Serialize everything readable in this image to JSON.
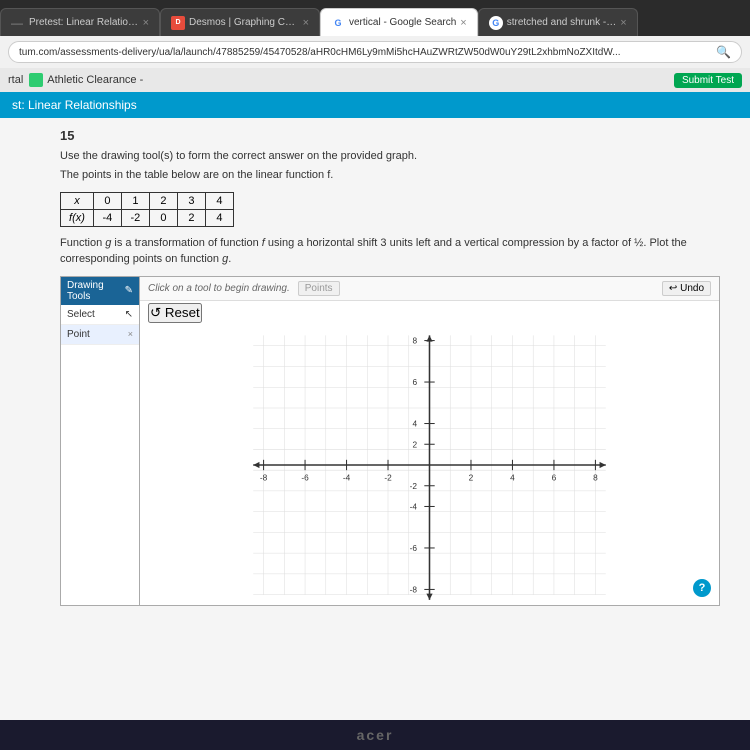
{
  "browser": {
    "tabs": [
      {
        "id": "tab1",
        "title": "Pretest: Linear Relationships",
        "favicon_type": "dash",
        "active": false
      },
      {
        "id": "tab2",
        "title": "Desmos | Graphing Calculas",
        "favicon_type": "desmos",
        "active": false
      },
      {
        "id": "tab3",
        "title": "vertical - Google Search",
        "favicon_type": "google",
        "active": true
      },
      {
        "id": "tab4",
        "title": "stretched and shrunk - Goo",
        "favicon_type": "google",
        "active": false
      }
    ],
    "address": "tum.com/assessments-delivery/ua/la/launch/47885259/45470528/aHR0cHM6Ly9mMi5hcHAuZWRtZW50dW0uY29tL2xhbmNoZXItdW..."
  },
  "portal_bar": {
    "text": "rtal",
    "athletic": "Athletic Clearance -",
    "submit_test": "Submit Test"
  },
  "test_header": {
    "title": "st: Linear Relationships"
  },
  "question": {
    "number": "15",
    "instruction1": "Use the drawing tool(s) to form the correct answer on the provided graph.",
    "instruction2": "The points in the table below are on the linear function f.",
    "table": {
      "headers": [
        "x",
        "0",
        "1",
        "2",
        "3",
        "4"
      ],
      "row": [
        "f(x)",
        "-4",
        "-2",
        "0",
        "2",
        "4"
      ]
    },
    "transformation_text": "Function g is a transformation of function f using a horizontal shift 3 units left and a vertical compression by a factor of ½. Plot the corresponding points on function g."
  },
  "drawing_tools": {
    "header": "Drawing Tools",
    "tools": [
      {
        "label": "Select",
        "icon": "cursor",
        "active": false
      },
      {
        "label": "Point",
        "icon": "point",
        "active": true
      }
    ]
  },
  "graph_toolbar": {
    "click_hint": "Click on a tool to begin drawing.",
    "points_label": "Points",
    "undo_label": "Undo",
    "reset_label": "Reset"
  },
  "graph": {
    "x_min": -8,
    "x_max": 8,
    "y_min": -8,
    "y_max": 8,
    "x_ticks": [
      -8,
      -6,
      -4,
      -2,
      2,
      4,
      6,
      8
    ],
    "y_ticks": [
      -8,
      -6,
      -4,
      -2,
      2,
      4,
      6,
      8
    ]
  },
  "help": {
    "symbol": "?"
  },
  "taskbar": {
    "logo": "acer"
  }
}
